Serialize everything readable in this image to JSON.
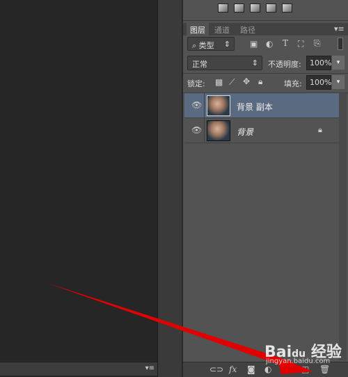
{
  "tabs": [
    {
      "label": "图层"
    },
    {
      "label": "通道"
    },
    {
      "label": "路径"
    }
  ],
  "filter": {
    "label": "类型",
    "icons": [
      "image-filter-icon",
      "adjustment-filter-icon",
      "text-filter-icon",
      "shape-filter-icon",
      "smart-object-filter-icon"
    ]
  },
  "blend_mode": "正常",
  "opacity": {
    "label": "不透明度:",
    "value": "100%"
  },
  "lock": {
    "label": "锁定:"
  },
  "fill": {
    "label": "填充:",
    "value": "100%"
  },
  "layers": [
    {
      "name": "背景 副本",
      "selected": true,
      "visible": true
    },
    {
      "name": "背景",
      "selected": false,
      "visible": true,
      "locked": true
    }
  ],
  "bottom_icons": [
    "link-icon",
    "fx-icon",
    "mask-icon",
    "adjustment-icon",
    "folder-icon",
    "new-layer-icon",
    "trash-icon"
  ],
  "fx_label": "fx",
  "watermark": {
    "logo": "Bai du 经验",
    "url": "jingyan.baidu.com"
  },
  "colors": {
    "selected_layer": "#5a6a80",
    "arrow": "#e00000"
  }
}
